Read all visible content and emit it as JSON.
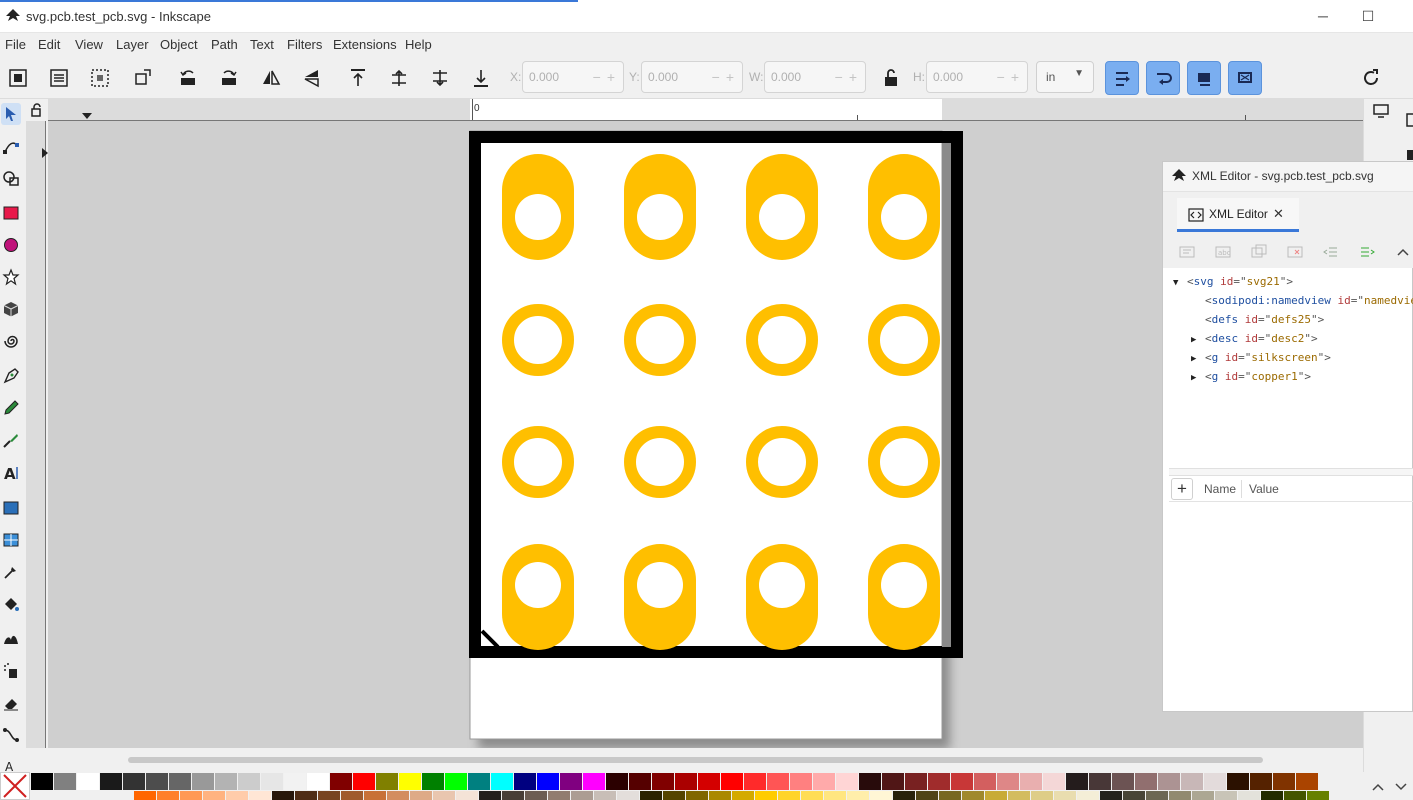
{
  "window": {
    "title": "svg.pcb.test_pcb.svg - Inkscape",
    "minimize": "─",
    "maximize": "☐"
  },
  "menu": [
    "File",
    "Edit",
    "View",
    "Layer",
    "Object",
    "Path",
    "Text",
    "Filters",
    "Extensions",
    "Help"
  ],
  "toolbar": {
    "x_label": "X:",
    "x_value": "0.000",
    "y_label": "Y:",
    "y_value": "0.000",
    "w_label": "W:",
    "w_value": "0.000",
    "h_label": "H:",
    "h_value": "0.000",
    "unit": "in"
  },
  "ruler": {
    "zero_label": "0"
  },
  "xml_editor": {
    "window_title": "XML Editor - svg.pcb.test_pcb.svg",
    "tab_label": "XML Editor",
    "tree": [
      {
        "tag": "svg",
        "attr": "id",
        "value": "svg21",
        "expanded": true
      },
      {
        "tag": "sodipodi:namedview",
        "attr": "id",
        "value": "namedview",
        "expandable": false
      },
      {
        "tag": "defs",
        "attr": "id",
        "value": "defs25",
        "expandable": false
      },
      {
        "tag": "desc",
        "attr": "id",
        "value": "desc2",
        "expandable": true
      },
      {
        "tag": "g",
        "attr": "id",
        "value": "silkscreen",
        "expandable": true
      },
      {
        "tag": "g",
        "attr": "id",
        "value": "copper1",
        "expandable": true
      }
    ],
    "attributes_header": {
      "name": "Name",
      "value": "Value"
    }
  },
  "colors": {
    "pad": "#ffbf00",
    "board_outline": "#000000",
    "canvas": "#cfcfcf",
    "accent": "#3a78d8"
  },
  "palette_row1": [
    "#000000",
    "#808080",
    "#ffffff",
    "#1a1a1a",
    "#333333",
    "#4d4d4d",
    "#666666",
    "#999999",
    "#b3b3b3",
    "#cccccc",
    "#e6e6e6",
    "#f2f2f2",
    "#ffffff",
    "#800000",
    "#ff0000",
    "#808000",
    "#ffff00",
    "#008000",
    "#00ff00",
    "#008080",
    "#00ffff",
    "#000080",
    "#0000ff",
    "#800080",
    "#ff00ff",
    "#2b0000",
    "#550000",
    "#800000",
    "#aa0000",
    "#d40000",
    "#ff0000",
    "#ff2a2a",
    "#ff5555",
    "#ff8080",
    "#ffaaaa",
    "#ffd5d5",
    "#280b0b",
    "#501616",
    "#782121",
    "#a02c2c",
    "#c83737",
    "#d35f5f",
    "#de8787",
    "#e9afaf",
    "#f4d7d7",
    "#241c1c",
    "#483737",
    "#6c5353",
    "#916f6f",
    "#ac9393",
    "#c8b7b7",
    "#e3dbdb",
    "#2b1100",
    "#552200",
    "#803300",
    "#aa4400"
  ],
  "palette_row2": [
    "#ff6600",
    "#ff7f2a",
    "#ff9955",
    "#ffb380",
    "#ffccaa",
    "#ffe6d5",
    "#28170b",
    "#502d16",
    "#784421",
    "#a05a2c",
    "#c87137",
    "#d38d5f",
    "#deaa87",
    "#e9c6af",
    "#f4e3d7",
    "#241f1c",
    "#483e37",
    "#6c5d53",
    "#917c6f",
    "#ac9d93",
    "#c8beb7",
    "#e3dedb",
    "#2b2200",
    "#554400",
    "#806600",
    "#aa8800",
    "#d4aa00",
    "#ffcc00",
    "#ffd42a",
    "#ffdd55",
    "#ffe680",
    "#ffeeaa",
    "#fff6d5",
    "#28220b",
    "#504416",
    "#786721",
    "#a0892c",
    "#c8ab37",
    "#d3bc5f",
    "#decd87",
    "#e9ddaf",
    "#f4eed7",
    "#24221c",
    "#484537",
    "#6c6753",
    "#918a6f",
    "#aca793",
    "#c8c4b7",
    "#e3e2db",
    "#222b00",
    "#445500",
    "#668000"
  ]
}
